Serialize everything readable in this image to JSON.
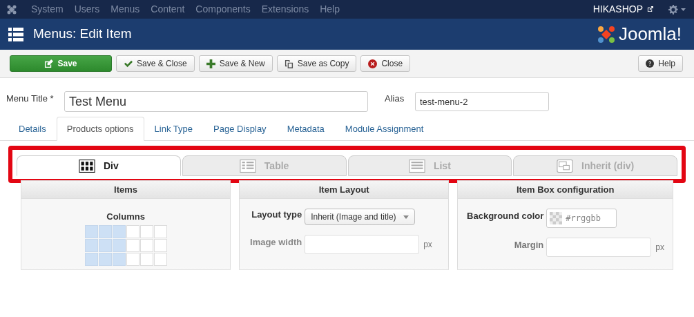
{
  "topmenu": {
    "items": [
      "System",
      "Users",
      "Menus",
      "Content",
      "Components",
      "Extensions",
      "Help"
    ],
    "user": "HIKASHOP"
  },
  "header": {
    "title": "Menus: Edit Item",
    "logo": "Joomla!"
  },
  "toolbar": {
    "buttons": [
      {
        "label": "Save",
        "kind": "primary"
      },
      {
        "label": "Save & Close",
        "kind": "default"
      },
      {
        "label": "Save & New",
        "kind": "default"
      },
      {
        "label": "Save as Copy",
        "kind": "default"
      },
      {
        "label": "Close",
        "kind": "default"
      }
    ],
    "help": "Help"
  },
  "form": {
    "title_label": "Menu Title *",
    "title_value": "Test Menu",
    "alias_label": "Alias",
    "alias_value": "test-menu-2"
  },
  "tabs": [
    {
      "label": "Details",
      "selected": false
    },
    {
      "label": "Products options",
      "selected": true
    },
    {
      "label": "Link Type",
      "selected": false
    },
    {
      "label": "Page Display",
      "selected": false
    },
    {
      "label": "Metadata",
      "selected": false
    },
    {
      "label": "Module Assignment",
      "selected": false
    }
  ],
  "layout_tabs": [
    {
      "label": "Div",
      "selected": true
    },
    {
      "label": "Table",
      "selected": false
    },
    {
      "label": "List",
      "selected": false
    },
    {
      "label": "Inherit (div)",
      "selected": false
    }
  ],
  "panels": {
    "items": {
      "title": "Items",
      "columns_label": "Columns",
      "grid": [
        {
          "cells": [
            true,
            true,
            true,
            false,
            false,
            false
          ]
        },
        {
          "cells": [
            true,
            true,
            true,
            false,
            false,
            false
          ]
        },
        {
          "cells": [
            true,
            true,
            true,
            false,
            false,
            false
          ]
        }
      ]
    },
    "layout": {
      "title": "Item Layout",
      "layout_label": "Layout type",
      "layout_value": "Inherit (Image and title)",
      "width_label": "Image width",
      "width_unit": "px"
    },
    "box": {
      "title": "Item Box configuration",
      "bg_label": "Background color",
      "bg_placeholder": "#rrggbb",
      "margin_label": "Margin",
      "margin_unit": "px"
    }
  }
}
